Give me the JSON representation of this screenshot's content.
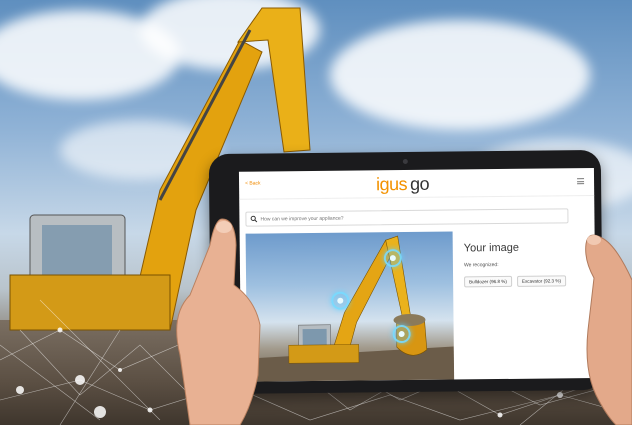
{
  "header": {
    "back_label": "< Back",
    "logo_word": "igus",
    "logo_suffix": "go",
    "menu_icon": "hamburger-menu-icon"
  },
  "search": {
    "placeholder": "How can we improve your appliance?",
    "icon": "search-icon"
  },
  "result": {
    "title": "Your image",
    "subtitle": "We recognized:",
    "tags": [
      "Bulldozer (96.8 %)",
      "Excavator (92.3 %)"
    ]
  },
  "colors": {
    "brand_orange": "#f39200",
    "hotspot_blue": "#5abef0"
  }
}
